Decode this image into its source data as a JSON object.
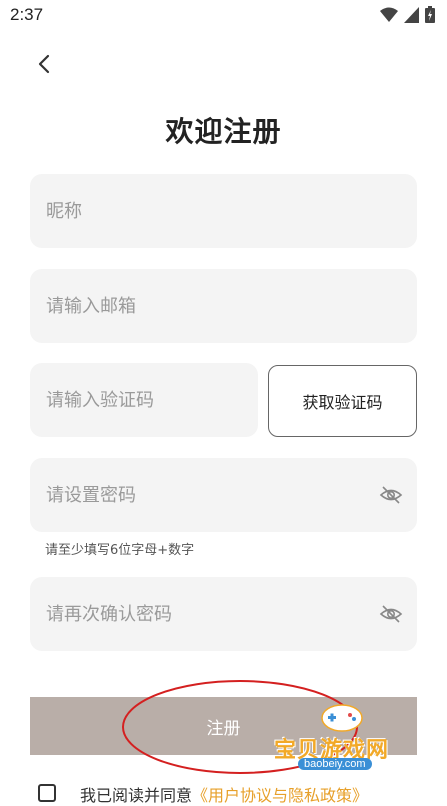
{
  "status_bar": {
    "time": "2:37"
  },
  "page": {
    "title": "欢迎注册"
  },
  "form": {
    "nickname_placeholder": "昵称",
    "email_placeholder": "请输入邮箱",
    "code_placeholder": "请输入验证码",
    "get_code_label": "获取验证码",
    "password_placeholder": "请设置密码",
    "password_hint": "请至少填写6位字母+数字",
    "confirm_placeholder": "请再次确认密码",
    "register_label": "注册"
  },
  "agreement": {
    "text": "我已阅读并同意",
    "link": "《用户协议与隐私政策》"
  },
  "watermark": {
    "text": "宝贝游戏网",
    "domain": "baobeiy.com"
  },
  "colors": {
    "button": "#b9aea8",
    "field_bg": "#f4f4f4",
    "annotation": "#d42020",
    "link": "#e7a02a"
  },
  "icons": [
    "back-arrow-icon",
    "wifi-icon",
    "signal-icon",
    "battery-icon",
    "eye-off-icon"
  ]
}
